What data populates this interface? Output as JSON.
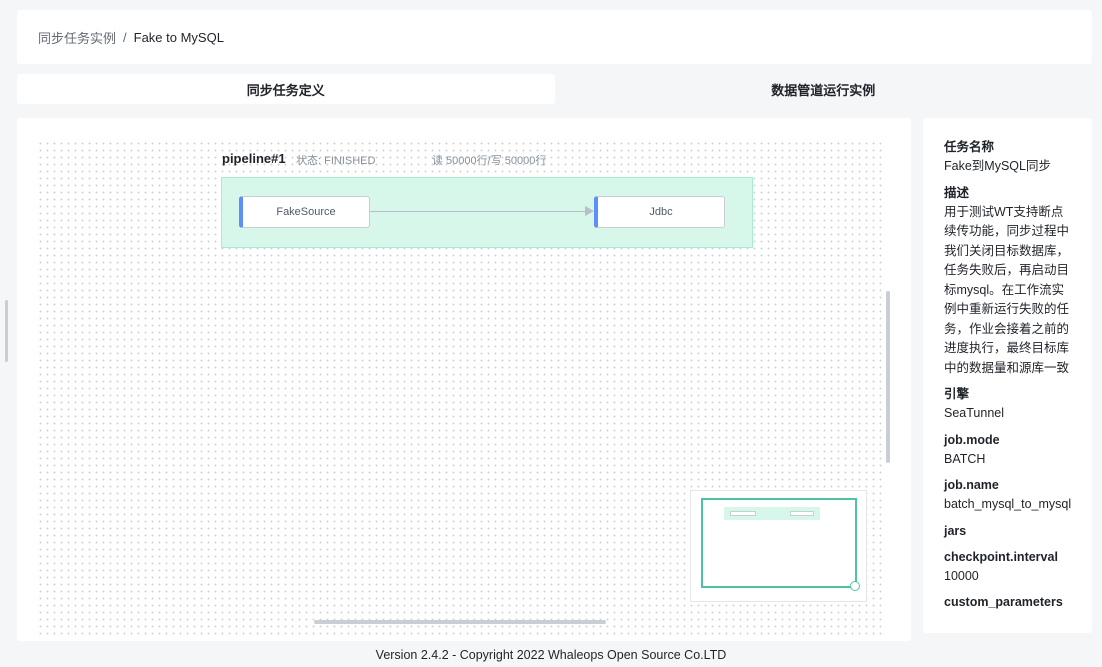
{
  "breadcrumb": {
    "parent": "同步任务实例",
    "separator": "/",
    "current": "Fake to MySQL"
  },
  "tabs": [
    {
      "label": "同步任务定义",
      "active": true
    },
    {
      "label": "数据管道运行实例",
      "active": false
    }
  ],
  "pipeline": {
    "title": "pipeline#1",
    "status": "状态: FINISHED",
    "read_write": "读 50000行/写 50000行",
    "source_node": "FakeSource",
    "sink_node": "Jdbc"
  },
  "info": [
    {
      "label": "任务名称",
      "value": "Fake到MySQL同步"
    },
    {
      "label": "描述",
      "value": "用于测试WT支持断点续传功能，同步过程中我们关闭目标数据库，任务失败后，再启动目标mysql。在工作流实例中重新运行失败的任务，作业会接着之前的进度执行，最终目标库中的数据量和源库一致"
    },
    {
      "label": "引擎",
      "value": "SeaTunnel"
    },
    {
      "label": "job.mode",
      "value": "BATCH"
    },
    {
      "label": "job.name",
      "value": "batch_mysql_to_mysql"
    },
    {
      "label": "jars",
      "value": ""
    },
    {
      "label": "checkpoint.interval",
      "value": "10000"
    },
    {
      "label": "custom_parameters",
      "value": ""
    }
  ],
  "footer": "Version 2.4.2 - Copyright 2022 Whaleops Open Source Co.LTD",
  "colors": {
    "pipeline_bg": "#d6f7ea",
    "node_accent": "#5b8ff9",
    "minimap_border": "#4fc3a1"
  }
}
